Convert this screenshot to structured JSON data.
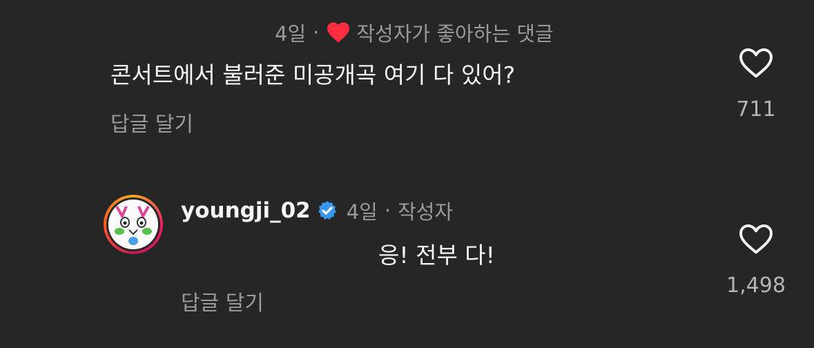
{
  "comment1": {
    "time": "4일",
    "separator": "·",
    "liked_by_author_label": "작성자가 좋아하는 댓글",
    "text": "콘서트에서 불러준 미공개곡 여기 다 있어?",
    "reply_label": "답글 달기",
    "like_count": "711",
    "heart_color": "#ff2d40"
  },
  "reply1": {
    "username": "youngji_02",
    "time": "4일",
    "separator": "·",
    "author_badge": "작성자",
    "text": "응! 전부 다!",
    "reply_label": "답글 달기",
    "like_count": "1,498",
    "verified_color": "#3897f0"
  },
  "icons": {
    "like": "heart-outline-icon",
    "liked_by_author": "heart-filled-icon",
    "verified": "verified-badge-icon"
  }
}
